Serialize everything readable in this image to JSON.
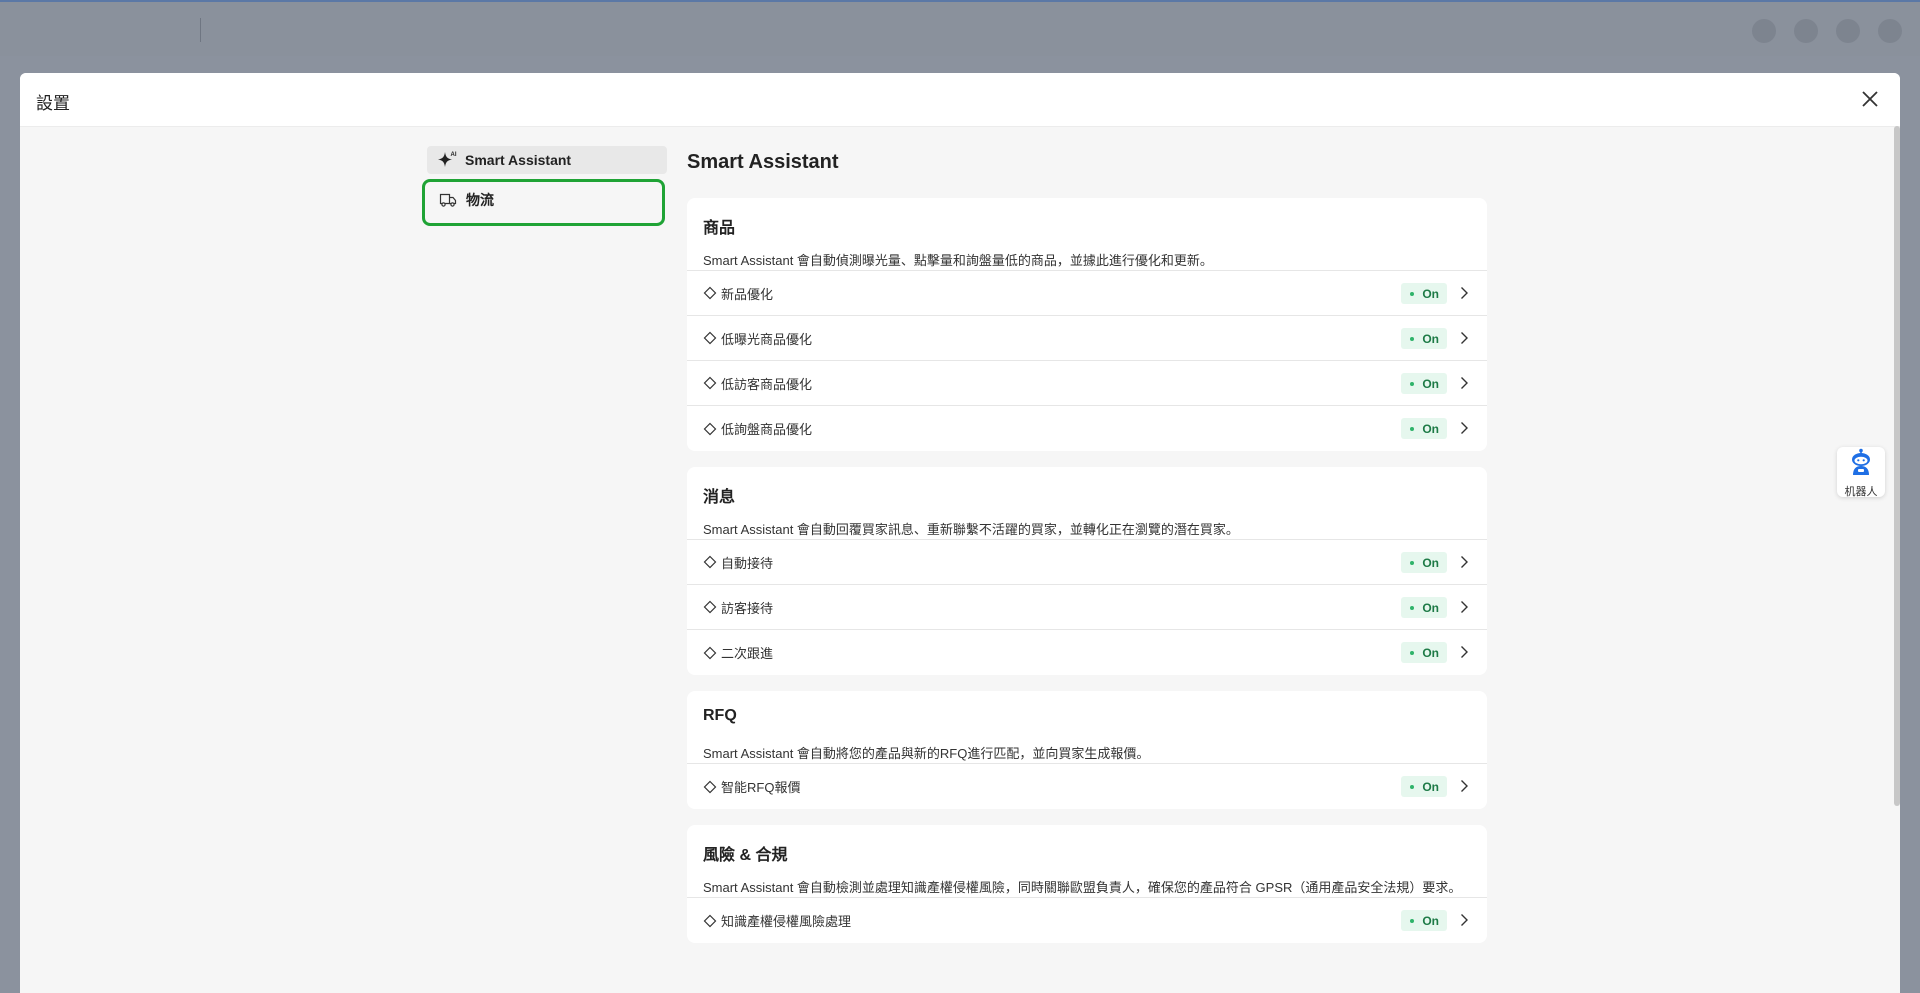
{
  "modal": {
    "title": "設置"
  },
  "sidebar": {
    "items": [
      {
        "label": "Smart Assistant",
        "icon": "ai-sparkle-icon"
      },
      {
        "label": "物流",
        "icon": "truck-icon"
      }
    ]
  },
  "main": {
    "title": "Smart Assistant",
    "sections": [
      {
        "title": "商品",
        "description": "Smart Assistant 會自動偵測曝光量、點擊量和詢盤量低的商品，並據此進行優化和更新。",
        "rows": [
          {
            "label": "新品優化",
            "status": "On"
          },
          {
            "label": "低曝光商品優化",
            "status": "On"
          },
          {
            "label": "低訪客商品優化",
            "status": "On"
          },
          {
            "label": "低詢盤商品優化",
            "status": "On"
          }
        ]
      },
      {
        "title": "消息",
        "description": "Smart Assistant 會自動回覆買家訊息、重新聯繫不活躍的買家，並轉化正在瀏覽的潛在買家。",
        "rows": [
          {
            "label": "自動接待",
            "status": "On"
          },
          {
            "label": "訪客接待",
            "status": "On"
          },
          {
            "label": "二次跟進",
            "status": "On"
          }
        ]
      },
      {
        "title": "RFQ",
        "description": "Smart Assistant 會自動將您的產品與新的RFQ進行匹配，並向買家生成報價。",
        "rows": [
          {
            "label": "智能RFQ報價",
            "status": "On"
          }
        ]
      },
      {
        "title": "風險 & 合規",
        "description": "Smart Assistant 會自動檢測並處理知識產權侵權風險，同時關聯歐盟負責人，確保您的產品符合 GPSR（通用產品安全法規）要求。",
        "rows": [
          {
            "label": "知識產權侵權風險處理",
            "status": "On"
          }
        ]
      }
    ]
  },
  "robot": {
    "label": "机器人"
  },
  "colors": {
    "highlight": "#1fa335",
    "status_bg": "#e6f7ee",
    "status_text": "#1d7a46"
  }
}
